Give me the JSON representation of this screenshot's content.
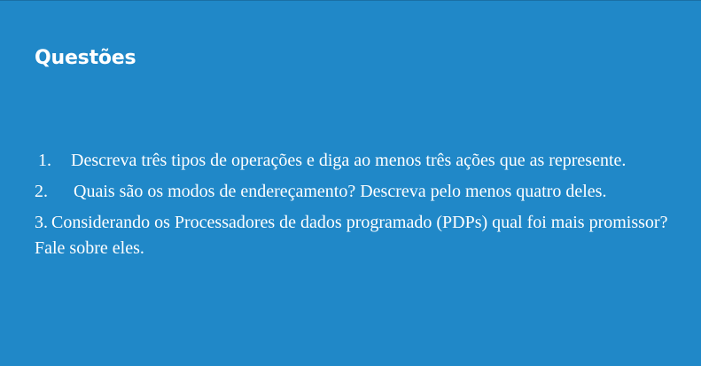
{
  "slide": {
    "title": "Questões",
    "background_color": "#2088c8",
    "text_color": "#ffffff",
    "questions": [
      {
        "number": "1.",
        "text": "Descreva três tipos de operações e diga ao menos três ações que as represente."
      },
      {
        "number": "2.",
        "text": "Quais são os modos de endereçamento? Descreva pelo menos quatro deles."
      },
      {
        "number": "3.",
        "text": "Considerando os Processadores de dados programado (PDPs) qual foi mais promissor? Fale sobre eles."
      }
    ]
  }
}
